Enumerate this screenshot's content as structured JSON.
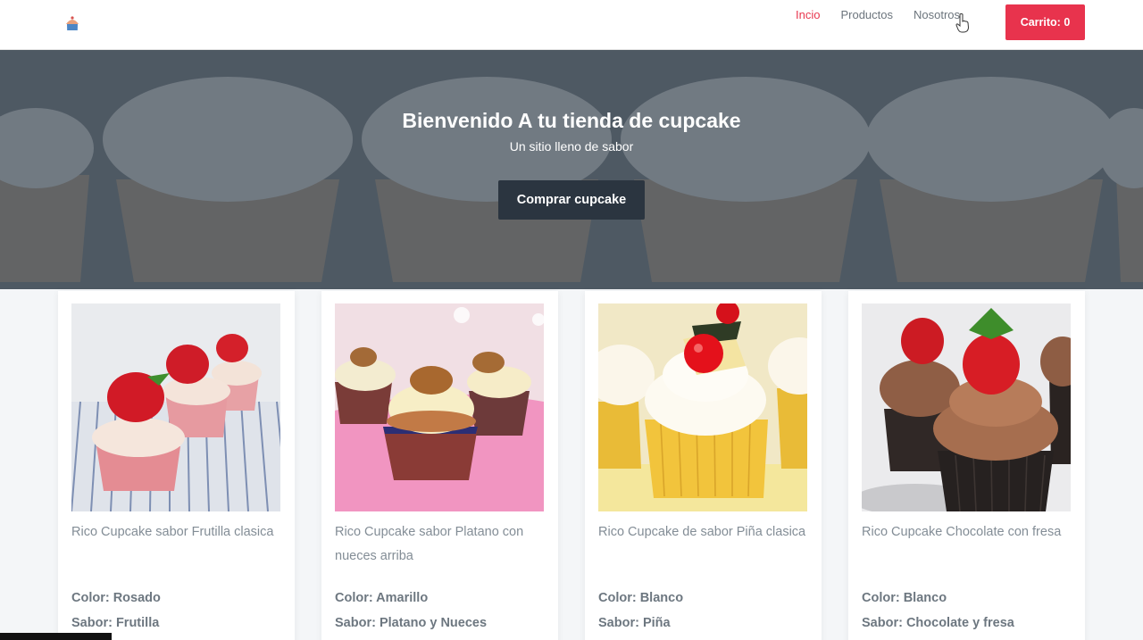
{
  "nav": {
    "links": [
      "Incio",
      "Productos",
      "Nosotros"
    ],
    "cart_label": "Carrito: 0"
  },
  "hero": {
    "title": "Bienvenido A tu tienda de cupcake",
    "subtitle": "Un sitio lleno de sabor",
    "button_label": "Comprar cupcake"
  },
  "products": [
    {
      "description": "Rico Cupcake sabor Frutilla clasica",
      "color": "Color: Rosado",
      "flavor": "Sabor: Frutilla"
    },
    {
      "description": "Rico Cupcake sabor Platano con nueces arriba",
      "color": "Color: Amarillo",
      "flavor": "Sabor: Platano y Nueces"
    },
    {
      "description": "Rico Cupcake de sabor Piña clasica",
      "color": "Color: Blanco",
      "flavor": "Sabor: Piña"
    },
    {
      "description": "Rico Cupcake Chocolate con fresa",
      "color": "Color: Blanco",
      "flavor": "Sabor: Chocolate y fresa"
    }
  ],
  "colors": {
    "accent": "#e8334d",
    "hero_button": "#2b3540"
  }
}
